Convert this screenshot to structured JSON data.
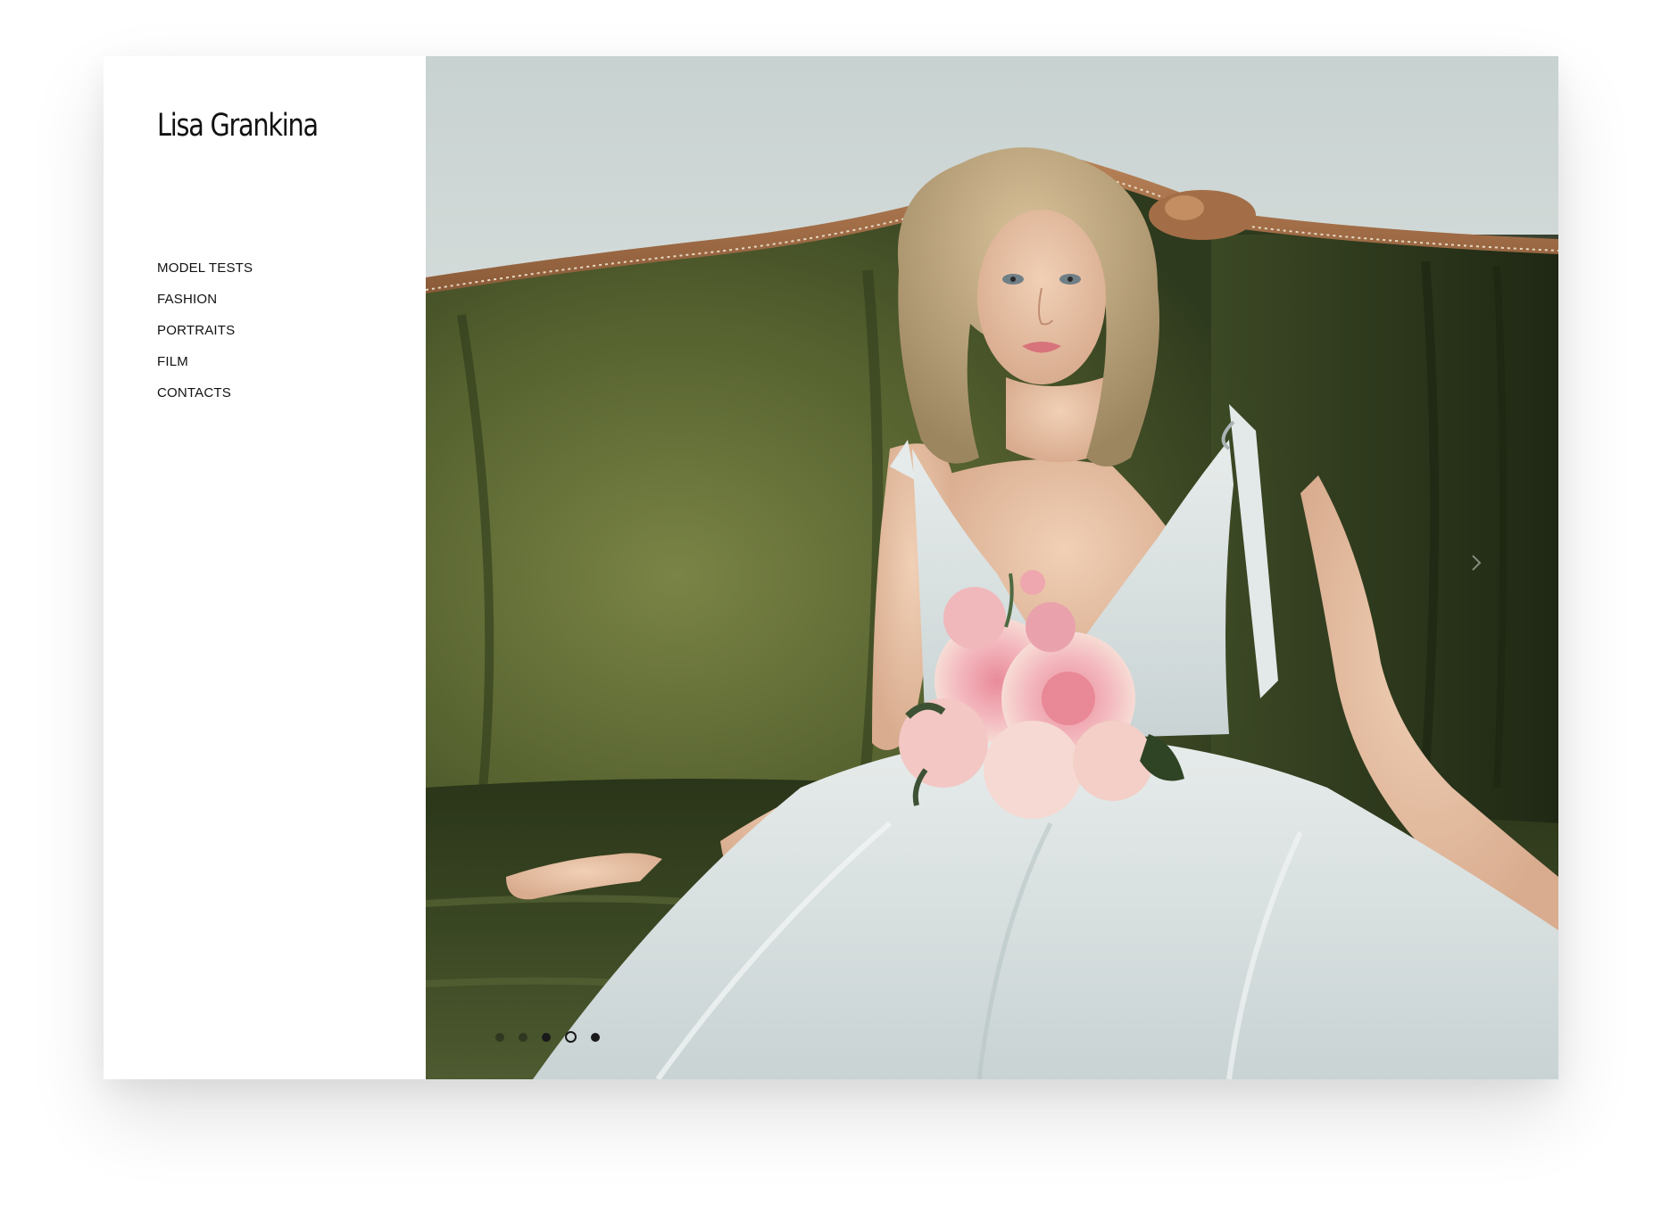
{
  "site": {
    "title": "Lisa Grankina"
  },
  "nav": {
    "items": [
      {
        "label": "MODEL TESTS"
      },
      {
        "label": "FASHION"
      },
      {
        "label": "PORTRAITS"
      },
      {
        "label": "FILM"
      },
      {
        "label": "CONTACTS"
      }
    ]
  },
  "slideshow": {
    "slide_count": 5,
    "active_slide": 4,
    "next_icon": "chevron-right-icon"
  },
  "colors": {
    "background": "#ffffff",
    "text": "#111111",
    "sofa_green": "#4b5a33",
    "wall": "#c9d3d2"
  }
}
